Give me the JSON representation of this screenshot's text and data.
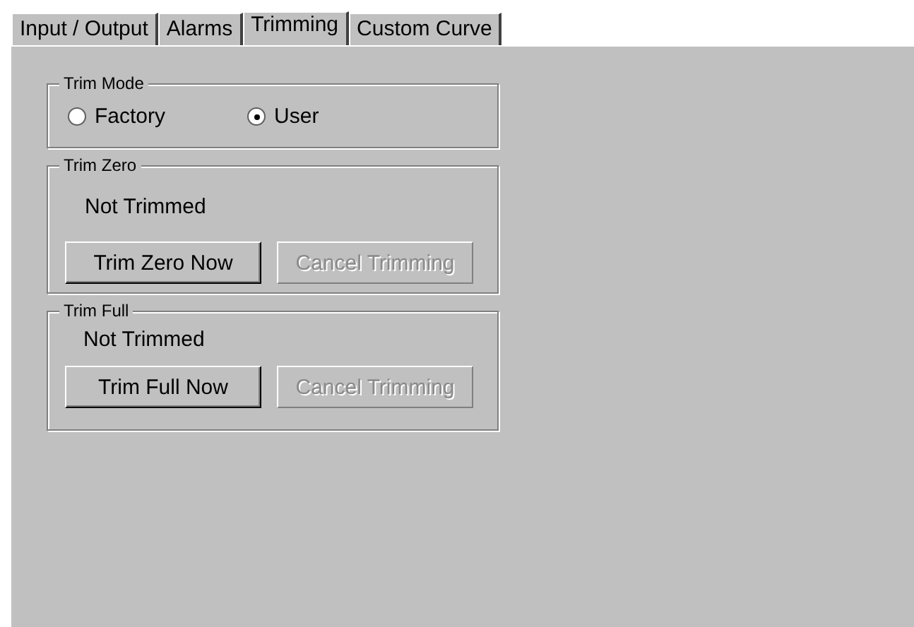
{
  "tabs": [
    {
      "label": "Input / Output",
      "selected": false
    },
    {
      "label": "Alarms",
      "selected": false
    },
    {
      "label": "Trimming",
      "selected": true
    },
    {
      "label": "Custom Curve",
      "selected": false
    }
  ],
  "trim_mode": {
    "title": "Trim Mode",
    "options": [
      {
        "label": "Factory",
        "selected": false
      },
      {
        "label": "User",
        "selected": true
      }
    ]
  },
  "groups": [
    {
      "title": "Trim Zero",
      "status": "Not Trimmed",
      "buttons": [
        {
          "label": "Trim Zero Now",
          "disabled": false
        },
        {
          "label": "Cancel Trimming",
          "disabled": true
        }
      ]
    },
    {
      "title": "Trim Full",
      "status": "Not Trimmed",
      "buttons": [
        {
          "label": "Trim Full Now",
          "disabled": false
        },
        {
          "label": "Cancel Trimming",
          "disabled": true
        }
      ]
    }
  ]
}
